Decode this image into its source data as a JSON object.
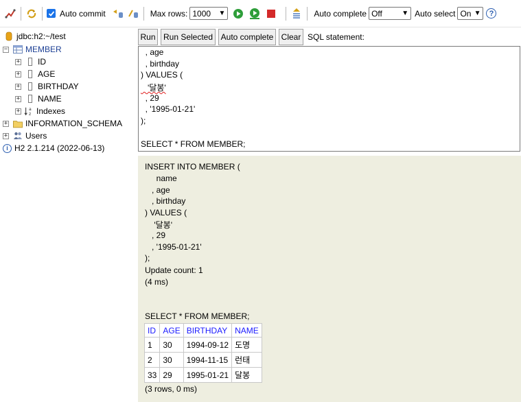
{
  "toolbar": {
    "auto_commit_label": "Auto commit",
    "max_rows_label": "Max rows:",
    "max_rows_value": "1000",
    "auto_complete_label": "Auto complete",
    "auto_complete_value": "Off",
    "auto_select_label": "Auto select",
    "auto_select_value": "On",
    "help_symbol": "?"
  },
  "tree": {
    "connection": "jdbc:h2:~/test",
    "table_name": "MEMBER",
    "columns": [
      "ID",
      "AGE",
      "BIRTHDAY",
      "NAME"
    ],
    "indexes_label": "Indexes",
    "schema_label": "INFORMATION_SCHEMA",
    "users_label": "Users",
    "version_label": "H2 2.1.214 (2022-06-13)"
  },
  "sql_buttons": {
    "run": "Run",
    "run_selected": "Run Selected",
    "auto_complete": "Auto complete",
    "clear": "Clear",
    "statement_label": "SQL statement:"
  },
  "editor_lines": [
    "  , age",
    "  , birthday",
    ") VALUES (",
    "   '달봉'",
    "  , 29",
    "  , '1995-01-21'",
    ");",
    "",
    "SELECT * FROM MEMBER;"
  ],
  "result": {
    "insert_lines": [
      "INSERT INTO MEMBER (",
      "     name",
      "   , age",
      "   , birthday",
      ") VALUES (",
      "    '달봉'",
      "   , 29",
      "   , '1995-01-21'",
      ");",
      "Update count: 1",
      "(4 ms)"
    ],
    "select_statement": "SELECT * FROM MEMBER;",
    "headers": [
      "ID",
      "AGE",
      "BIRTHDAY",
      "NAME"
    ],
    "rows": [
      [
        "1",
        "30",
        "1994-09-12",
        "도명"
      ],
      [
        "2",
        "30",
        "1994-11-15",
        "런태"
      ],
      [
        "33",
        "29",
        "1995-01-21",
        "달봉"
      ]
    ],
    "summary": "(3 rows, 0 ms)"
  },
  "colors": {
    "result_bg": "#eeeee0",
    "header_text": "#1a1aff",
    "tree_link": "#1c3f94"
  }
}
